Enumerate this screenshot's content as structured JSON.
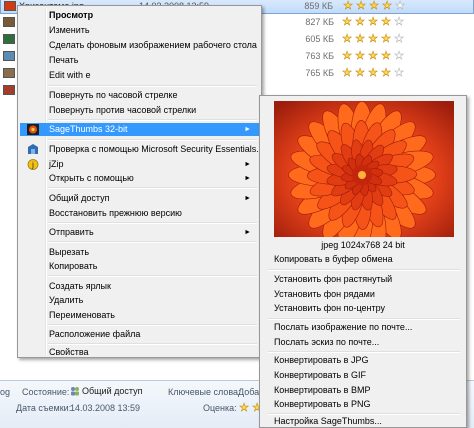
{
  "file_list": {
    "rows": [
      {
        "name": "Хризантема.jpg",
        "date": "14.03.2008 13:59",
        "size": "859 КБ",
        "rating": 4,
        "selected": true
      },
      {
        "name": "",
        "date": "",
        "size": "827 КБ",
        "rating": 4,
        "selected": false
      },
      {
        "name": "",
        "date": "",
        "size": "605 КБ",
        "rating": 4,
        "selected": false
      },
      {
        "name": "",
        "date": "",
        "size": "763 КБ",
        "rating": 4,
        "selected": false
      },
      {
        "name": "",
        "date": "",
        "size": "765 КБ",
        "rating": 4,
        "selected": false
      },
      {
        "name": "",
        "date": "",
        "size": "",
        "rating": 0,
        "selected": false
      }
    ],
    "star_colors": {
      "filled": "#ffd75c",
      "empty": "#ffffff"
    }
  },
  "context_menu": {
    "items": {
      "preview": "Просмотр",
      "edit": "Изменить",
      "set_wallpaper": "Сделать фоновым изображением рабочего стола",
      "print": "Печать",
      "edit_with": "Edit with e",
      "rotate_cw": "Повернуть по часовой стрелке",
      "rotate_ccw": "Повернуть против часовой стрелки",
      "sagethumbs": "SageThumbs 32-bit",
      "mse_scan": "Проверка с помощью Microsoft Security Essentials...",
      "jzip": "jZip",
      "open_with": "Открыть с помощью",
      "share": "Общий доступ",
      "restore": "Восстановить прежнюю версию",
      "send_to": "Отправить",
      "cut": "Вырезать",
      "copy": "Копировать",
      "create_shortcut": "Создать ярлык",
      "delete": "Удалить",
      "rename": "Переименовать",
      "file_location": "Расположение файла",
      "properties": "Свойства"
    }
  },
  "submenu": {
    "image_info": "jpeg 1024x768 24 bit",
    "items": {
      "copy_clipboard": "Копировать в буфер обмена",
      "bg_stretch": "Установить фон растянутый",
      "bg_tile": "Установить фон рядами",
      "bg_center": "Установить фон по-центру",
      "mail_image": "Послать изображение по почте...",
      "mail_thumb": "Послать эскиз по почте...",
      "to_jpg": "Конвертировать в JPG",
      "to_gif": "Конвертировать в GIF",
      "to_bmp": "Конвертировать в BMP",
      "to_png": "Конвертировать в PNG",
      "settings": "Настройка SageThumbs..."
    }
  },
  "details_pane": {
    "left_fragment": "og",
    "state_label": "Состояние:",
    "state_value": "Общий доступ",
    "keywords_label": "Ключевые слова:",
    "keywords_value": "Доба",
    "date_label": "Дата съемки:",
    "date_value": "14.03.2008 13:59",
    "rating_label": "Оценка:",
    "rating": 4
  },
  "colors": {
    "highlight": "#3399ff",
    "menu_bg": "#f0f0f0"
  },
  "icons": {
    "rotate": "sagethumbs-logo-icon",
    "mse": "shield-house-icon",
    "jzip": "jzip-icon",
    "shared": "people-icon"
  }
}
